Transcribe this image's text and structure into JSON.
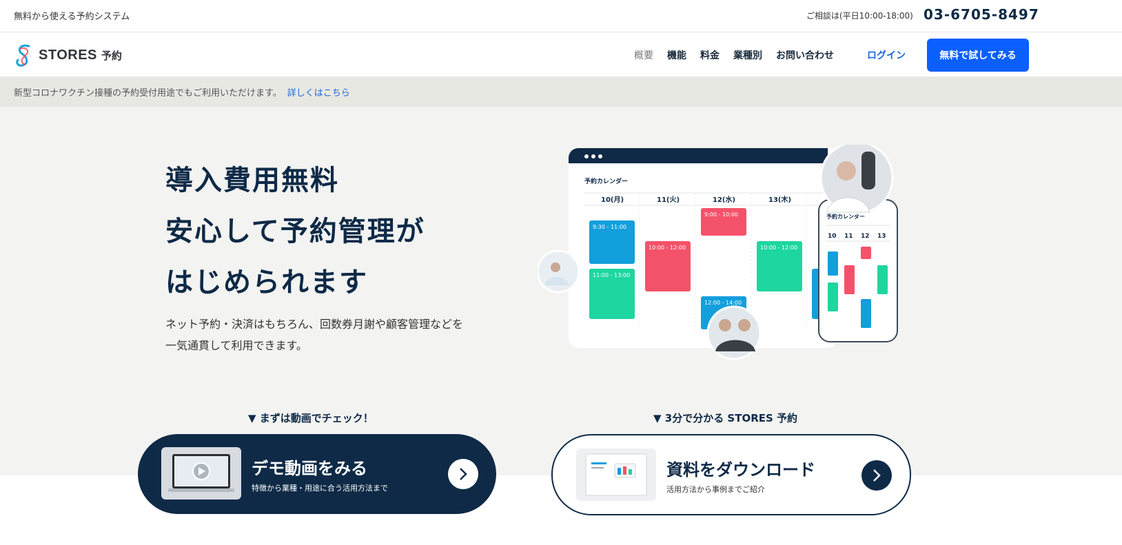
{
  "topbar": {
    "tagline": "無料から使える予約システム",
    "hours": "ご相談は(平日10:00-18:00)",
    "phone": "03-6705-8497"
  },
  "header": {
    "logo_brand": "STORES",
    "logo_sub": "予約",
    "nav": [
      "概要",
      "機能",
      "料金",
      "業種別",
      "お問い合わせ"
    ],
    "login": "ログイン",
    "cta": "無料で試してみる"
  },
  "notice": {
    "text": "新型コロナワクチン接種の予約受付用途でもご利用いただけます。",
    "link": "詳しくはこちら"
  },
  "hero": {
    "headline": [
      "導入費用無料",
      "安心して予約管理が",
      "はじめられます"
    ],
    "lead": [
      "ネット予約・決済はもちろん、回数券月謝や顧客管理などを",
      "一気通貫して利用できます。"
    ]
  },
  "illustration": {
    "calendar_title": "予約カレンダー",
    "days": [
      "10(月)",
      "11(火)",
      "12(水)",
      "13(木)"
    ],
    "slots": [
      "9:30 - 11:00",
      "11:00 - 13:00",
      "10:00 - 12:00",
      "9:00 - 10:00",
      "12:00 - 14:00",
      "10:00 - 12:00"
    ],
    "phone_title": "予約カレンダー",
    "phone_days": [
      "10",
      "11",
      "12",
      "13"
    ],
    "colors": {
      "blue": "#139fdb",
      "green": "#1ed6a0",
      "red": "#f4526a",
      "navy": "#0e2a47"
    }
  },
  "demo": {
    "caption": "▼ まずは動画でチェック！",
    "title": "デモ動画をみる",
    "subtitle": "特徴から業種・用途に合う活用方法まで"
  },
  "doc": {
    "caption": "▼ 3分で分かる STORES 予約",
    "title": "資料をダウンロード",
    "subtitle": "活用方法から事例までご紹介"
  }
}
